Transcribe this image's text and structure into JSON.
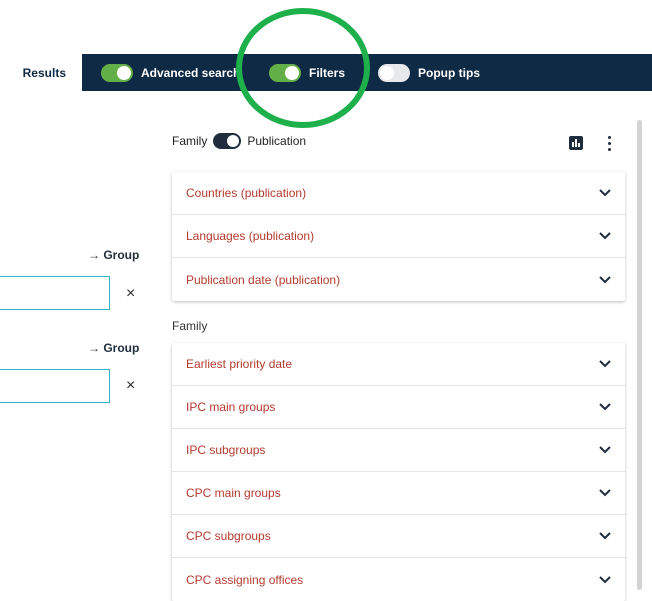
{
  "topbar": {
    "results_tab": "Results",
    "toggles": [
      {
        "label": "Advanced search",
        "state": "on"
      },
      {
        "label": "Filters",
        "state": "on"
      },
      {
        "label": "Popup tips",
        "state": "off"
      }
    ]
  },
  "left": {
    "group_links": [
      "→ Group",
      "→ Group"
    ],
    "clear_symbol": "×"
  },
  "panel": {
    "mode_left": "Family",
    "mode_right": "Publication",
    "publication_filters": [
      "Countries (publication)",
      "Languages (publication)",
      "Publication date (publication)"
    ],
    "family_heading": "Family",
    "family_filters": [
      "Earliest priority date",
      "IPC main groups",
      "IPC subgroups",
      "CPC main groups",
      "CPC subgroups",
      "CPC assigning offices"
    ]
  },
  "colors": {
    "navy": "#0f2a44",
    "toggle_on": "#64b048",
    "filter_label": "#b23a2e",
    "annotation": "#1eb14b",
    "input_border": "#2fb3c9"
  },
  "icons": [
    "bar-chart-icon",
    "more-vertical-icon",
    "chevron-down-icon",
    "close-icon"
  ]
}
